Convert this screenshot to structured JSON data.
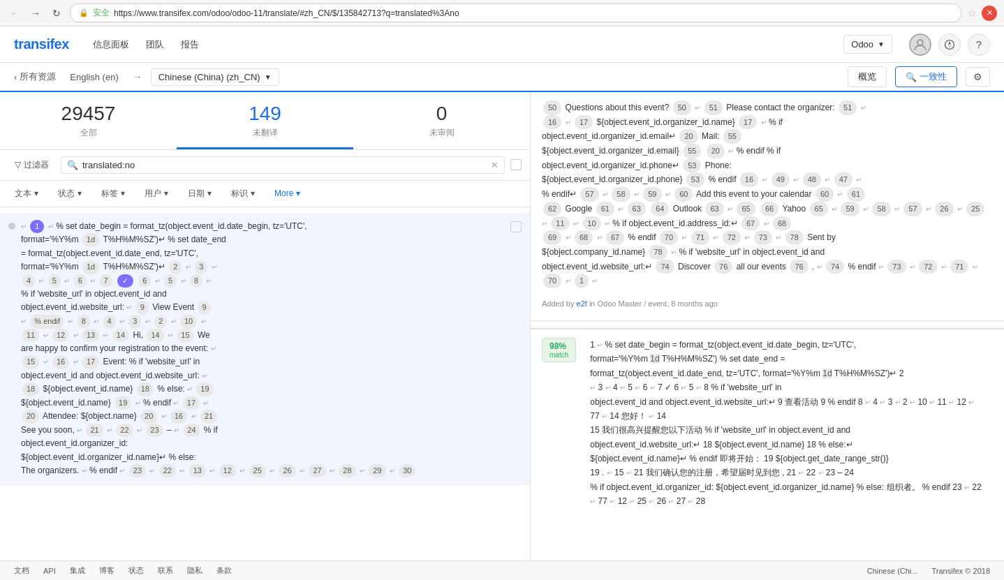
{
  "browser": {
    "url": "https://www.transifex.com/odoo/odoo-11/translate/#zh_CN/$/135842713?q=translated%3Ano",
    "lock_icon": "🔒",
    "secure_text": "安全"
  },
  "header": {
    "logo": "transifex",
    "nav": [
      "信息面板",
      "团队",
      "报告"
    ],
    "project": "Odoo",
    "icons": {
      "compass": "🧭",
      "help": "?"
    }
  },
  "sub_nav": {
    "back_label": "所有资源",
    "lang_from": "English (en)",
    "arrow": "→",
    "lang_to": "Chinese (China) (zh_CN)",
    "btn_overview": "概览",
    "btn_consistency": "一致性",
    "btn_settings": "⚙"
  },
  "stats": {
    "total": {
      "number": "29457",
      "label": "全部"
    },
    "untranslated": {
      "number": "149",
      "label": "未翻译"
    },
    "unreviewed": {
      "number": "0",
      "label": "未审阅"
    }
  },
  "filters": {
    "filter_label": "过滤器",
    "search_value": "translated:no",
    "tags": [
      {
        "label": "文本",
        "has_arrow": true
      },
      {
        "label": "状态",
        "has_arrow": true
      },
      {
        "label": "标签",
        "has_arrow": true
      },
      {
        "label": "用户",
        "has_arrow": true
      },
      {
        "label": "日期",
        "has_arrow": true
      },
      {
        "label": "标识",
        "has_arrow": true
      },
      {
        "label": "More",
        "has_arrow": true
      }
    ]
  },
  "translation_items": [
    {
      "id": "item1",
      "content": "% set date_begin = format_tz(object.event_id.date_begin, tz='UTC', format='%Y%m 1×d T%H%M%SZ') % set date_end = format_tz(object.event_id.date_end, tz='UTC', format='%Y%m 1×d T%H%M%SZ') 2 3 4 5 6 7 6 5 8 % if 'website_url' in object.event_id and object.event_id.website_url: 9 View Event 9 % endif 8 4 3 2 10 11 12 13 14 Hi, 14 15 We are happy to confirm your registration to the event: 15 16 17 Event: % if 'website_url' in object.event_id and object.event_id.website_url: 18 ${object.event_id.name} 18 % else: 19 ${object.event_id.name} 19 % endif 17 20 Attendee: ${object.name} 20 16 21 See you soon, 21 22 23 – 24 % if object.event_id.organizer_id: ${object.event_id.organizer_id.name} % else: The organizers. % endif 23 22 13 12 25 26 27 28 29 30",
      "selected": true,
      "badges": [
        {
          "text": "1",
          "type": "purple"
        },
        {
          "text": "1d",
          "type": "small"
        },
        {
          "text": "1",
          "type": "purple"
        },
        {
          "text": "1d",
          "type": "small"
        }
      ]
    }
  ],
  "right_panel": {
    "source_content": "50 Questions about this event? 50 51 Please contact the organizer: 51 16 17 ${object.event_id.organizer_id.name} 17 % if object.event_id.organizer_id.email 20 Mail: 55 ${object.event_id.organizer_id.email} 55 20 % endif % if object.event_id.organizer_id.phone 53 Phone: ${object.event_id.organizer_id.phone} 53 % endif 16 49 48 47 % endif 57 58 59 60 Add this event to your calendar 60 61 62 Google 61 63 64 Outlook 63 65 66 Yahoo 65 59 58 57 26 25 11 10 % if object.event_id.address_id: 67 68 69 68 67 % endif 70 71 72 73 78 Sent by ${object.company_id.name} 78 % if 'website_url' in object.event_id and object.event_id.website_url: 74 Discover 76 all our events 76 . 74 % endif 73 72 71 70 1",
    "added_by": "Added by e2f in Odoo Master / event, 8 months ago",
    "match_percent": "98%",
    "match_label": "match",
    "match_content": "1 % set date_begin = format_tz(object.event_id.date_begin, tz='UTC', format='%Y%m 1×d T%H%M%SZ') % set date_end = format_tz(object.event_id.date_end, tz='UTC', format='%Y%m 1×d T%H%M%SZ') 2 3 4 5 6 7 6 5 8 % if 'website_url' in object.event_id and object.event_id.website_url: 9 查看活动 9 % endif 8 4 3 2 10 11 12 77 14 您好！ 14 15 我们很高兴提醒您以下活动 % if 'website_url' in object.event_id and object.event_id.website_url: 18 ${object.event_id.name} 18 % else: ${object.event_id.name} % endif 即将开始： 19 ${object.get_date_range_str()} 19 . 15 21 我们确认您的注册，希望届时见到您 , 21 22 23 – 24 % if object.event_id.organizer_id: ${object.event_id.organizer_id.name} % else: 组织者。 % endif 23 22 77 12 25 26 27 28"
  },
  "footer": {
    "links": [
      "文档",
      "API",
      "集成",
      "博客",
      "状态",
      "联系",
      "隐私",
      "条款"
    ],
    "right": "Chinese (Chi...",
    "copyright": "Transifex © 2018"
  }
}
